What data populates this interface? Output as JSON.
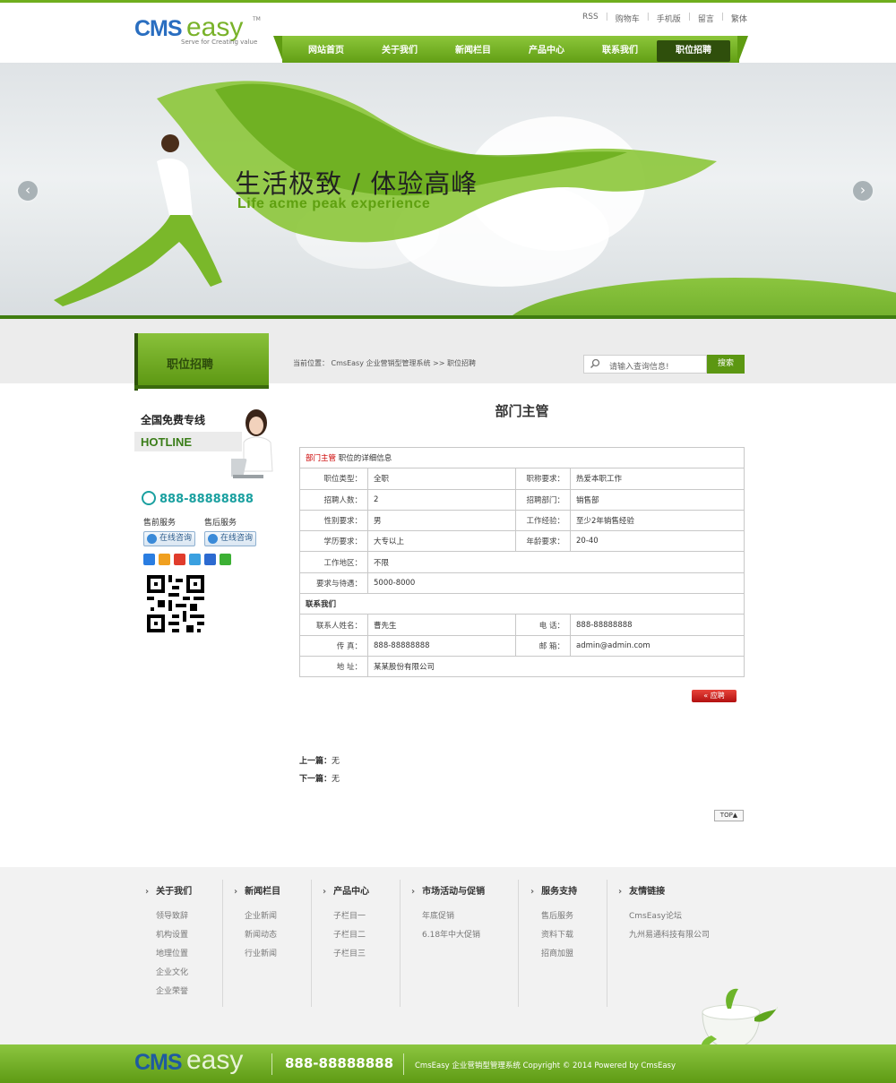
{
  "header": {
    "logo_cms": "CMS",
    "logo_easy": "easy",
    "logo_tm": "TM",
    "logo_slogan": "Serve for Creating value",
    "toplinks": [
      "RSS",
      "购物车",
      "手机版",
      "留言",
      "繁体"
    ]
  },
  "nav": {
    "items": [
      "网站首页",
      "关于我们",
      "新闻栏目",
      "产品中心",
      "联系我们",
      "职位招聘"
    ],
    "active_index": 5
  },
  "banner": {
    "title": "生活极致 / 体验高峰",
    "subtitle": "Life acme  peak experience",
    "prev_arrow": "‹",
    "next_arrow": "›"
  },
  "section": {
    "title": "职位招聘",
    "breadcrumb": "当前位置： CmsEasy 企业营销型管理系统   >>   职位招聘"
  },
  "search": {
    "placeholder": "请输入查询信息!",
    "button": "搜索"
  },
  "sidebar": {
    "hotline_title": "全国免费专线",
    "hotline_en": "HOTLINE",
    "phone": "888-88888888",
    "presale": "售前服务",
    "aftersale": "售后服务",
    "consult1": "在线咨询",
    "consult2": "在线咨询",
    "share_colors": [
      "#2a7de1",
      "#f0a020",
      "#e03c2c",
      "#3aa0e0",
      "#2c6ad0",
      "#3cb034"
    ]
  },
  "job": {
    "title": "部门主管",
    "detail_heading_red": "部门主管",
    "detail_heading": " 职位的详细信息",
    "rows": [
      {
        "k1": "职位类型：",
        "v1": "全职",
        "k2": "职称要求：",
        "v2": "热爱本职工作"
      },
      {
        "k1": "招聘人数：",
        "v1": "2",
        "k2": "招聘部门：",
        "v2": "销售部"
      },
      {
        "k1": "性别要求：",
        "v1": "男",
        "k2": "工作经验：",
        "v2": "至少2年销售经验"
      },
      {
        "k1": "学历要求：",
        "v1": "大专以上",
        "k2": "年龄要求：",
        "v2": "20-40"
      }
    ],
    "area_k": "工作地区：",
    "area_v": "不限",
    "salary_k": "要求与待遇：",
    "salary_v": "5000-8000",
    "contact_heading": "联系我们",
    "contact_k1": "联系人姓名：",
    "contact_v1": "曹先生",
    "tel_k": "电  话：",
    "tel_v": "888-88888888",
    "fax_k": "传  真：",
    "fax_v": "888-88888888",
    "mail_k": "邮  箱：",
    "mail_v": "admin@admin.com",
    "addr_k": "地  址：",
    "addr_v": "某某股份有限公司",
    "apply_button": "«   应聘",
    "prev_label": "上一篇：",
    "prev_value": "无",
    "next_label": "下一篇：",
    "next_value": "无",
    "top_button": "TOP▲"
  },
  "footer": {
    "columns": [
      {
        "title": "关于我们",
        "items": [
          "领导致辞",
          "机构设置",
          "地理位置",
          "企业文化",
          "企业荣誉"
        ]
      },
      {
        "title": "新闻栏目",
        "items": [
          "企业新闻",
          "新闻动态",
          "行业新闻"
        ]
      },
      {
        "title": "产品中心",
        "items": [
          "子栏目一",
          "子栏目二",
          "子栏目三"
        ]
      },
      {
        "title": "市场活动与促销",
        "items": [
          "年底促销",
          "6.18年中大促销"
        ]
      },
      {
        "title": "服务支持",
        "items": [
          "售后服务",
          "资料下载",
          "招商加盟"
        ]
      },
      {
        "title": "友情链接",
        "items": [
          "CmsEasy论坛",
          "九州易通科技有限公司"
        ]
      }
    ],
    "logo_cms": "CMS",
    "logo_easy": "easy",
    "phone": "888-88888888",
    "copyright": "CmsEasy 企业营销型管理系统  Copyright © 2014   Powered by CmsEasy"
  },
  "colors": {
    "brand_green": "#6fae1e",
    "dark_green": "#2f4f0c",
    "phone_teal": "#1aa0a0",
    "apply_red": "#c41a14"
  }
}
